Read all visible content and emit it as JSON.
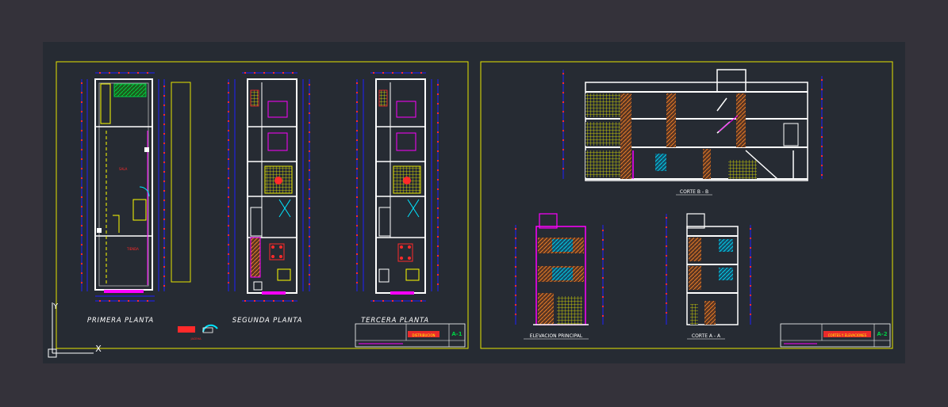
{
  "sheets": [
    {
      "plans": [
        {
          "title": "PRIMERA PLANTA"
        },
        {
          "title": "SEGUNDA PLANTA"
        },
        {
          "title": "TERCERA PLANTA"
        }
      ],
      "legend_label": "JACEHA",
      "titleblock": {
        "name": "DISTRIBUCION",
        "number": "A-1"
      }
    },
    {
      "views": {
        "section_bb": "CORTE B - B",
        "elevation": "ELEVACION PRINCIPAL",
        "section_aa": "CORTE A - A"
      },
      "titleblock": {
        "name": "CORTES Y ELEVACIONES",
        "number": "A-2"
      }
    }
  ],
  "ucs": {
    "y_label": "Y",
    "x_label": "X"
  },
  "colors": {
    "background": "#34323a",
    "paper": "#262b33",
    "frame": "#e6e600",
    "wall": "#ffffff",
    "dimension": "#1f1fff",
    "text_red": "#ff2a2a",
    "accent_magenta": "#ff00ff",
    "accent_cyan": "#00e5ff",
    "accent_green": "#00cc44"
  }
}
